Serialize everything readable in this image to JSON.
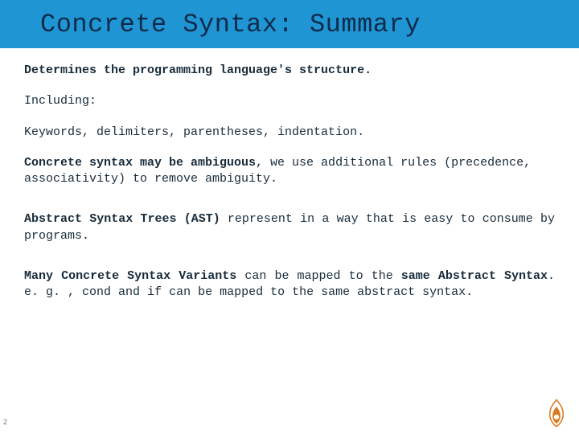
{
  "title": "Concrete Syntax: Summary",
  "p1": "Determines the programming language's structure.",
  "p2": "Including:",
  "p3": "Keywords, delimiters, parentheses, indentation.",
  "p4_a": "Concrete syntax may be ambiguous",
  "p4_b": ", we use additional rules (precedence, associativity) to remove ambiguity.",
  "p5_a": "Abstract Syntax Trees (AST)",
  "p5_b": " represent in a way that is easy to consume by programs.",
  "p6_a": "Many Concrete Syntax Variants",
  "p6_b": " can be mapped to the ",
  "p6_c": "same Abstract Syntax",
  "p6_d": ". e. g. , ",
  "p6_e": "cond",
  "p6_f": " and ",
  "p6_g": "if",
  "p6_h": " can be mapped to the same abstract syntax.",
  "pageNumber": "2"
}
